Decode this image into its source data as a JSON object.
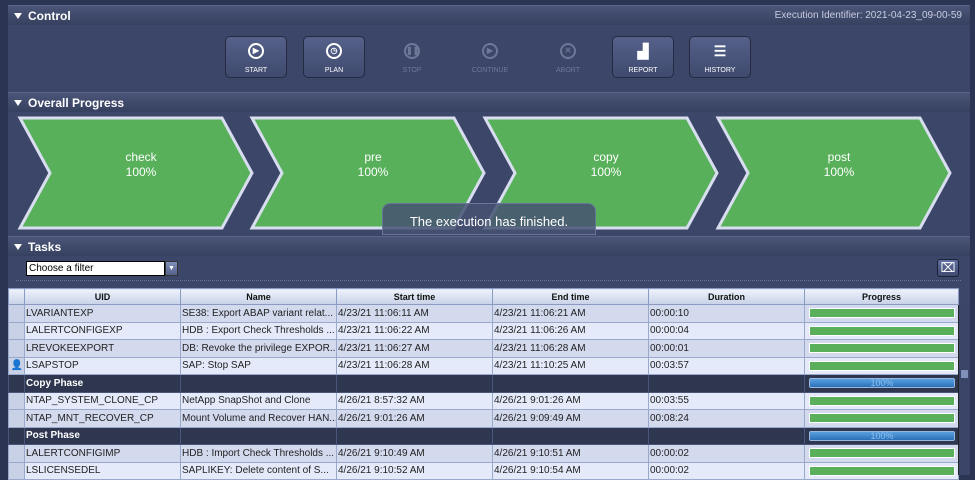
{
  "control": {
    "title": "Control",
    "execution_identifier": "Execution Identifier: 2021-04-23_09-00-59",
    "buttons": [
      {
        "label": "START",
        "icon": "play-icon",
        "glyph": "▶",
        "enabled": true
      },
      {
        "label": "PLAN",
        "icon": "clock-icon",
        "glyph": "◷",
        "enabled": true
      },
      {
        "label": "STOP",
        "icon": "pause-icon",
        "glyph": "❚❚",
        "enabled": false
      },
      {
        "label": "CONTINUE",
        "icon": "resume-icon",
        "glyph": "▶",
        "enabled": false
      },
      {
        "label": "ABORT",
        "icon": "abort-icon",
        "glyph": "✕",
        "enabled": false
      },
      {
        "label": "REPORT",
        "icon": "bar-chart-icon",
        "glyph": "▟",
        "enabled": true
      },
      {
        "label": "HISTORY",
        "icon": "list-icon",
        "glyph": "☰",
        "enabled": true
      }
    ]
  },
  "overall": {
    "title": "Overall Progress",
    "phases": [
      {
        "name": "check",
        "percent": "100%"
      },
      {
        "name": "pre",
        "percent": "100%"
      },
      {
        "name": "copy",
        "percent": "100%"
      },
      {
        "name": "post",
        "percent": "100%"
      }
    ],
    "color": "#58b05a",
    "toast": "The execution has finished."
  },
  "tasks": {
    "title": "Tasks",
    "filter_placeholder": "Choose a filter",
    "columns": [
      "UID",
      "Name",
      "Start time",
      "End time",
      "Duration",
      "Progress"
    ],
    "rows": [
      {
        "uid": "LVARIANTEXP",
        "name": "SE38: Export ABAP variant relat...",
        "start": "4/23/21 11:06:11 AM",
        "end": "4/23/21 11:06:21 AM",
        "duration": "00:00:10",
        "progress": 100
      },
      {
        "uid": "LALERTCONFIGEXP",
        "name": "HDB : Export Check Thresholds ...",
        "start": "4/23/21 11:06:22 AM",
        "end": "4/23/21 11:06:26 AM",
        "duration": "00:00:04",
        "progress": 100
      },
      {
        "uid": "LREVOKEEXPORT",
        "name": "DB: Revoke the privilege EXPOR...",
        "start": "4/23/21 11:06:27 AM",
        "end": "4/23/21 11:06:28 AM",
        "duration": "00:00:01",
        "progress": 100
      },
      {
        "uid": "LSAPSTOP",
        "name": "SAP: Stop SAP",
        "start": "4/23/21 11:06:28 AM",
        "end": "4/23/21 11:10:25 AM",
        "duration": "00:03:57",
        "progress": 100,
        "user": true
      },
      {
        "phase": "Copy Phase",
        "progress_label": "100%"
      },
      {
        "uid": "NTAP_SYSTEM_CLONE_CP",
        "name": "NetApp SnapShot and Clone",
        "start": "4/26/21 8:57:32 AM",
        "end": "4/26/21 9:01:26 AM",
        "duration": "00:03:55",
        "progress": 100
      },
      {
        "uid": "NTAP_MNT_RECOVER_CP",
        "name": "Mount Volume and Recover HAN...",
        "start": "4/26/21 9:01:26 AM",
        "end": "4/26/21 9:09:49 AM",
        "duration": "00:08:24",
        "progress": 100
      },
      {
        "phase": "Post Phase",
        "progress_label": "100%"
      },
      {
        "uid": "LALERTCONFIGIMP",
        "name": "HDB : Import Check Thresholds ...",
        "start": "4/26/21 9:10:49 AM",
        "end": "4/26/21 9:10:51 AM",
        "duration": "00:00:02",
        "progress": 100
      },
      {
        "uid": "LSLICENSEDEL",
        "name": "SAPLIKEY: Delete content of S...",
        "start": "4/26/21 9:10:52 AM",
        "end": "4/26/21 9:10:54 AM",
        "duration": "00:00:02",
        "progress": 100
      }
    ]
  }
}
